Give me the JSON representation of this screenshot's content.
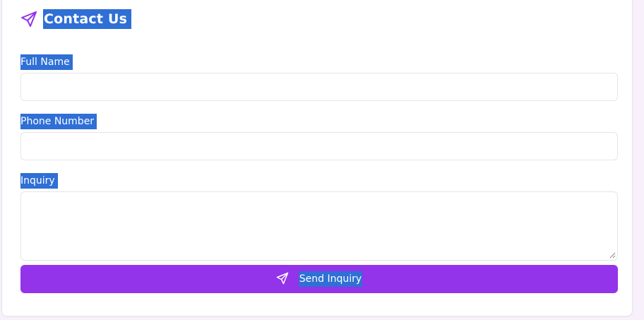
{
  "form": {
    "title": "Contact Us",
    "fields": [
      {
        "label": "Full Name",
        "value": "",
        "placeholder": ""
      },
      {
        "label": "Phone Number",
        "value": "",
        "placeholder": ""
      },
      {
        "label": "Inquiry",
        "value": "",
        "placeholder": ""
      }
    ],
    "submit_label": "Send Inquiry"
  },
  "icons": {
    "title_icon": "send-icon",
    "button_icon": "send-icon"
  },
  "colors": {
    "accent": "#9333ea",
    "selection": "#2f6fd6",
    "background": "#f8f1fb"
  }
}
